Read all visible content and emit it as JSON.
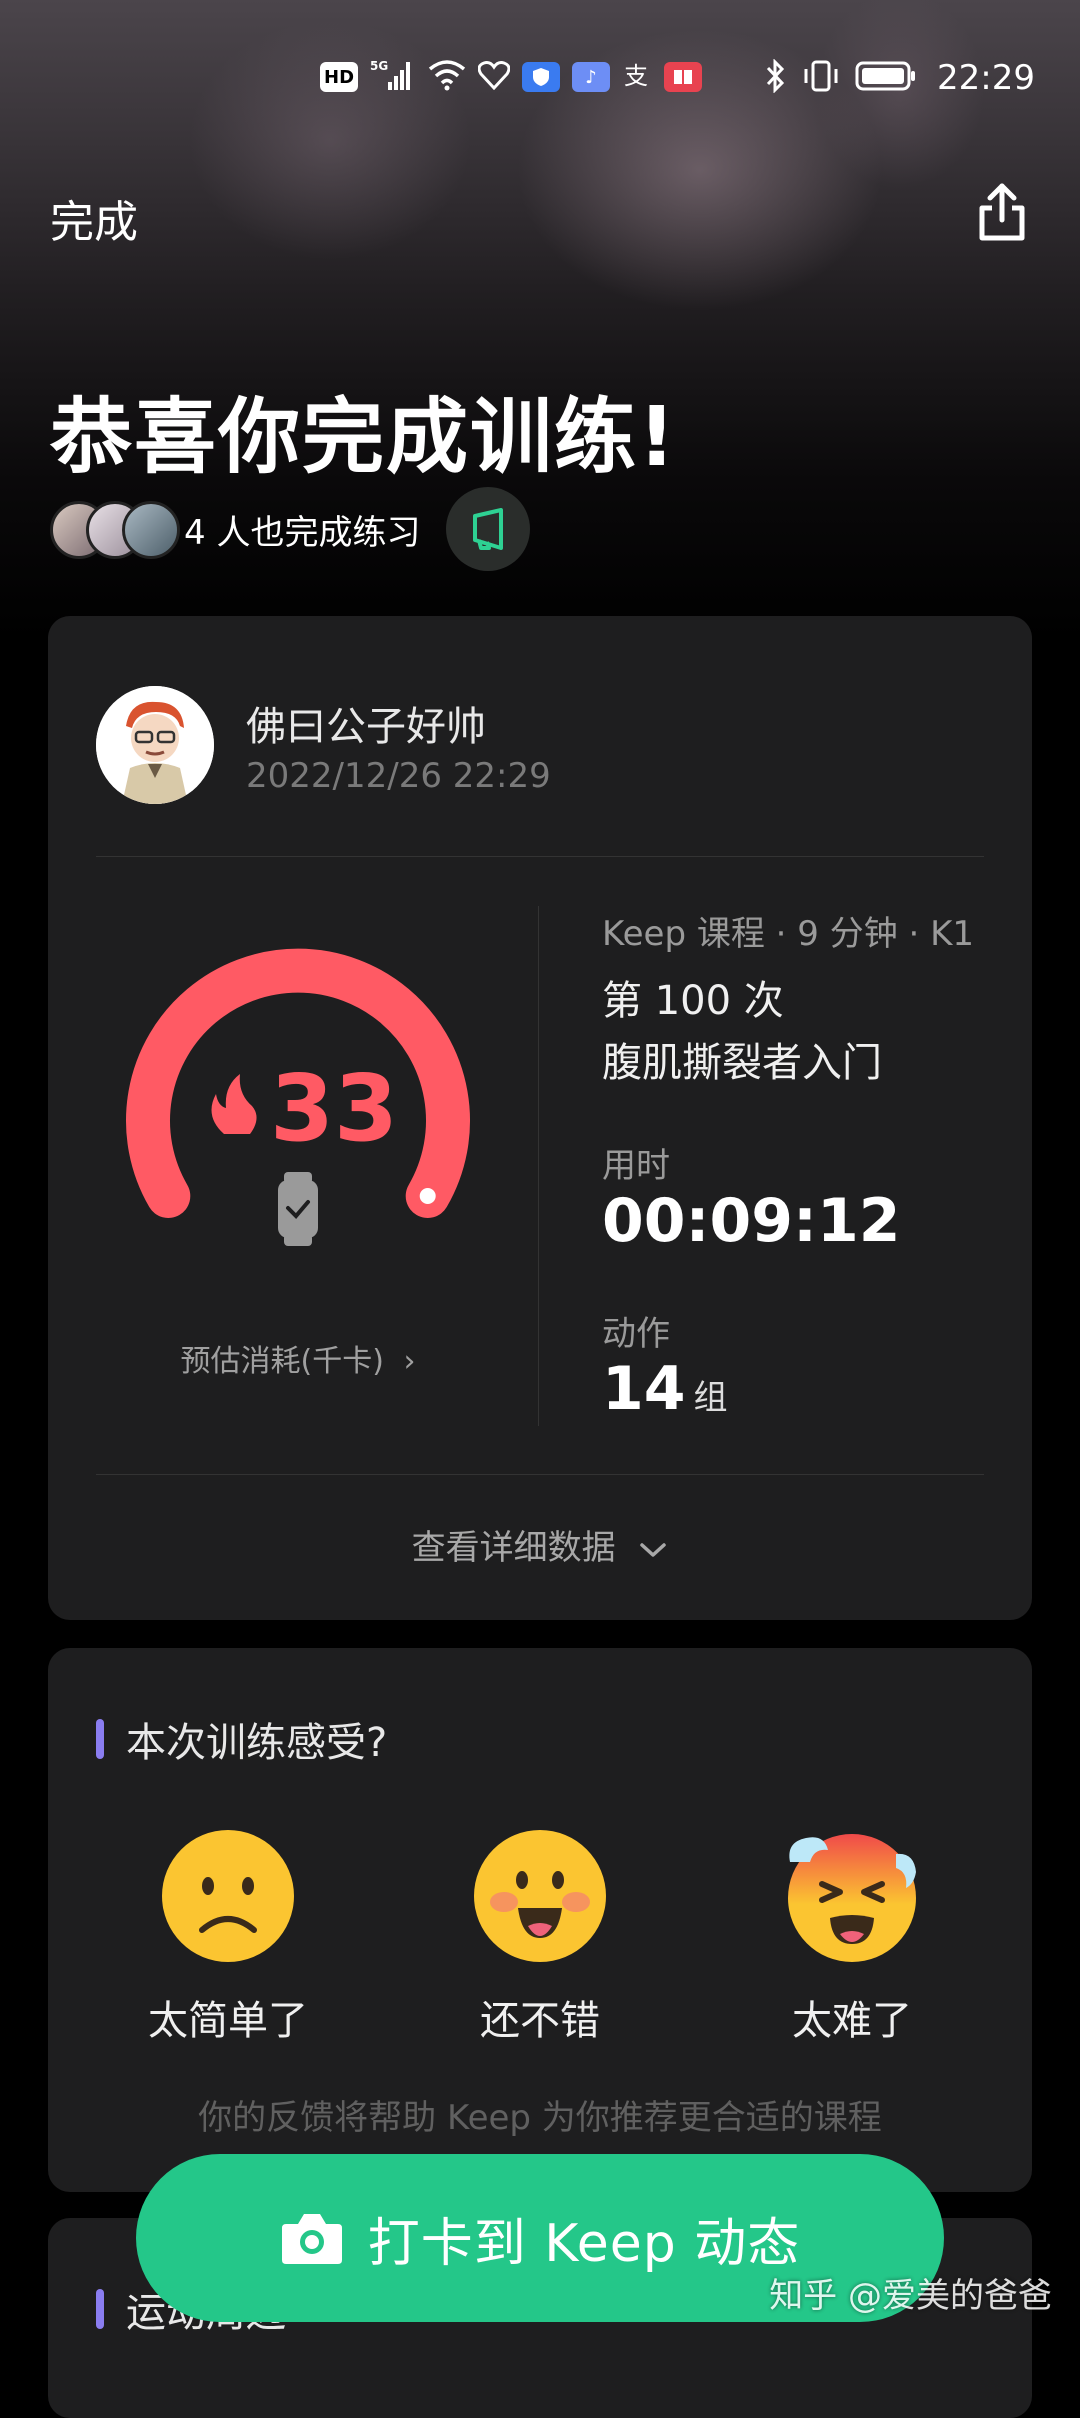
{
  "status_bar": {
    "hd_label": "HD",
    "network_label": "5G",
    "time": "22:29"
  },
  "nav": {
    "done_label": "完成"
  },
  "hero": {
    "title": "恭喜你完成训练!",
    "others_text": "4 人也完成练习"
  },
  "summary": {
    "user_name": "佛曰公子好帅",
    "timestamp": "2022/12/26 22:29",
    "calories": "33",
    "calories_label": "预估消耗(千卡)",
    "calories_chevron": "›",
    "course_meta": "Keep 课程 · 9 分钟 · K1",
    "session_count": "第 100 次",
    "course_name": "腹肌撕裂者入门",
    "duration_label": "用时",
    "duration_value": "00:09:12",
    "actions_label": "动作",
    "actions_value": "14",
    "actions_unit": "组",
    "detail_link": "查看详细数据"
  },
  "feel": {
    "title": "本次训练感受?",
    "options": [
      {
        "label": "太简单了",
        "icon": "sad-face-icon"
      },
      {
        "label": "还不错",
        "icon": "happy-face-icon"
      },
      {
        "label": "太难了",
        "icon": "exhausted-face-icon"
      }
    ],
    "note": "你的反馈将帮助 Keep 为你推荐更合适的课程"
  },
  "next_section": {
    "title": "运动周边"
  },
  "checkin_button": {
    "label": "打卡到 Keep 动态"
  },
  "watermark": "知乎 @爱美的爸爸",
  "colors": {
    "accent_green": "#24c789",
    "gauge_red": "#ff5a64",
    "section_bar": "#8a7df0",
    "card_bg": "#1e1e1f"
  }
}
